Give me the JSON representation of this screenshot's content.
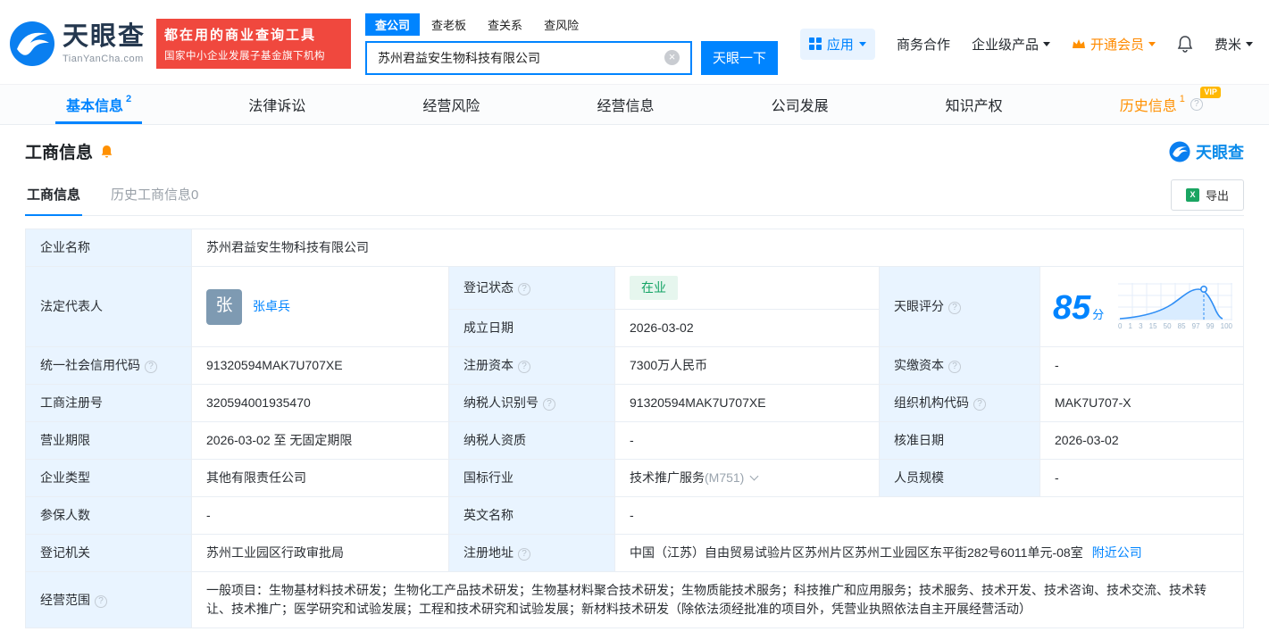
{
  "header": {
    "logo": {
      "brand": "天眼查",
      "domain": "TianYanCha.com"
    },
    "promo": {
      "line1": "都在用的商业查询工具",
      "line2": "国家中小企业发展子基金旗下机构"
    },
    "search": {
      "tabs": [
        {
          "label": "查公司"
        },
        {
          "label": "查老板"
        },
        {
          "label": "查关系"
        },
        {
          "label": "查风险"
        }
      ],
      "value": "苏州君益安生物科技有限公司",
      "button": "天眼一下"
    },
    "nav": {
      "apps": "应用",
      "cooperation": "商务合作",
      "enterprise": "企业级产品",
      "vip": "开通会员",
      "user": "费米"
    }
  },
  "tabs": [
    {
      "label": "基本信息",
      "sup": "2"
    },
    {
      "label": "法律诉讼"
    },
    {
      "label": "经营风险"
    },
    {
      "label": "经营信息"
    },
    {
      "label": "公司发展"
    },
    {
      "label": "知识产权"
    },
    {
      "label": "历史信息",
      "sup": "1",
      "badge": "VIP"
    }
  ],
  "section": {
    "title": "工商信息",
    "watermark": "天眼查",
    "subtabs": [
      {
        "label": "工商信息"
      },
      {
        "label": "历史工商信息0"
      }
    ],
    "export_label": "导出"
  },
  "fields": {
    "company_name": {
      "label": "企业名称",
      "value": "苏州君益安生物科技有限公司"
    },
    "legal_rep": {
      "label": "法定代表人",
      "avatar": "张",
      "value": "张卓兵"
    },
    "reg_status": {
      "label": "登记状态",
      "value": "在业"
    },
    "establish_date": {
      "label": "成立日期",
      "value": "2026-03-02"
    },
    "score": {
      "label": "天眼评分",
      "value": "85",
      "unit": "分",
      "ticks": [
        "0",
        "1",
        "3",
        "15",
        "50",
        "85",
        "97",
        "99",
        "100"
      ]
    },
    "credit_code": {
      "label": "统一社会信用代码",
      "value": "91320594MAK7U707XE"
    },
    "reg_capital": {
      "label": "注册资本",
      "value": "7300万人民币"
    },
    "paid_capital": {
      "label": "实缴资本",
      "value": "-"
    },
    "reg_number": {
      "label": "工商注册号",
      "value": "320594001935470"
    },
    "taxpayer_id": {
      "label": "纳税人识别号",
      "value": "91320594MAK7U707XE"
    },
    "org_code": {
      "label": "组织机构代码",
      "value": "MAK7U707-X"
    },
    "business_term": {
      "label": "营业期限",
      "value": "2026-03-02 至 无固定期限"
    },
    "taxpayer_qual": {
      "label": "纳税人资质",
      "value": "-"
    },
    "approval_date": {
      "label": "核准日期",
      "value": "2026-03-02"
    },
    "company_type": {
      "label": "企业类型",
      "value": "其他有限责任公司"
    },
    "industry": {
      "label": "国标行业",
      "value": "技术推广服务",
      "code": "(M751)"
    },
    "staff_size": {
      "label": "人员规模",
      "value": "-"
    },
    "insured_count": {
      "label": "参保人数",
      "value": "-"
    },
    "english_name": {
      "label": "英文名称",
      "value": "-"
    },
    "reg_authority": {
      "label": "登记机关",
      "value": "苏州工业园区行政审批局"
    },
    "reg_address": {
      "label": "注册地址",
      "value": "中国（江苏）自由贸易试验片区苏州片区苏州工业园区东平街282号6011单元-08室",
      "link": "附近公司"
    },
    "business_scope": {
      "label": "经营范围",
      "value": "一般项目：生物基材料技术研发；生物化工产品技术研发；生物基材料聚合技术研发；生物质能技术服务；科技推广和应用服务；技术服务、技术开发、技术咨询、技术交流、技术转让、技术推广；医学研究和试验发展；工程和技术研究和试验发展；新材料技术研发（除依法须经批准的项目外，凭营业执照依法自主开展经营活动）"
    }
  }
}
